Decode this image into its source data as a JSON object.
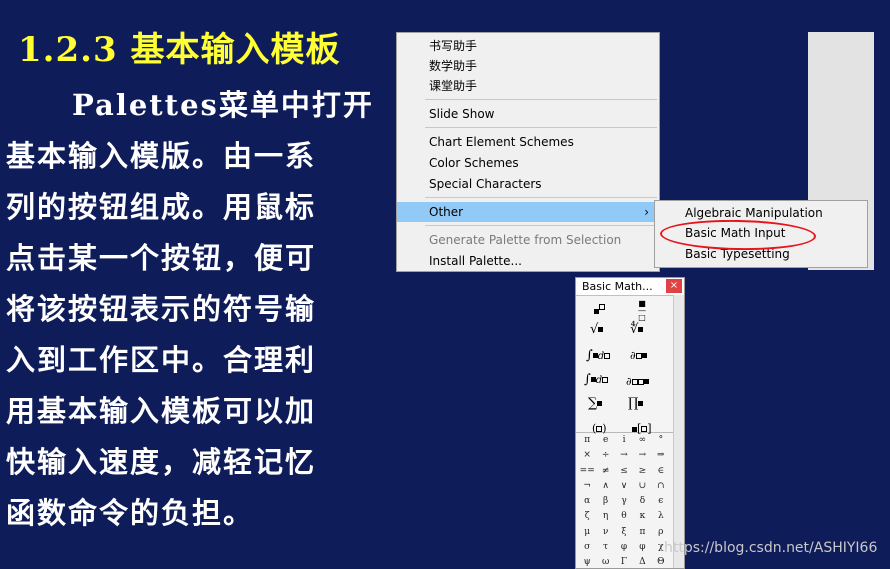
{
  "slide": {
    "title": "1.2.3  基本输入模板",
    "body_lines": [
      "Palettes菜单中打开",
      "基本输入模版。由一系",
      "列的按钮组成。用鼠标",
      "点击某一个按钮，便可",
      "将该按钮表示的符号输",
      "入到工作区中。合理利",
      "用基本输入模板可以加",
      "快输入速度，减轻记忆",
      "函数命令的负担。"
    ]
  },
  "menu": {
    "items": [
      {
        "label": "书写助手"
      },
      {
        "label": "数学助手"
      },
      {
        "label": "课堂助手"
      },
      {
        "label": "Slide Show"
      },
      {
        "label": "Chart Element Schemes"
      },
      {
        "label": "Color Schemes"
      },
      {
        "label": "Special Characters"
      },
      {
        "label": "Other"
      },
      {
        "label": "Generate Palette from Selection"
      },
      {
        "label": "Install Palette..."
      }
    ],
    "submenu_arrow": "›"
  },
  "submenu": {
    "items": [
      {
        "label": "Algebraic Manipulation"
      },
      {
        "label": "Basic Math Input"
      },
      {
        "label": "Basic Typesetting"
      }
    ]
  },
  "palette": {
    "title": "Basic Math...",
    "close": "×",
    "grid": [
      [
        "π",
        "e",
        "i",
        "∞",
        "°"
      ],
      [
        "×",
        "÷",
        "→",
        "→",
        "⇒"
      ],
      [
        "==",
        "≠",
        "≤",
        "≥",
        "∈"
      ],
      [
        "¬",
        "∧",
        "∨",
        "∪",
        "∩"
      ],
      [
        "α",
        "β",
        "γ",
        "δ",
        "ϵ"
      ],
      [
        "ζ",
        "η",
        "θ",
        "κ",
        "λ"
      ],
      [
        "μ",
        "ν",
        "ξ",
        "π",
        "ρ"
      ],
      [
        "σ",
        "τ",
        "φ",
        "φ",
        "χ"
      ],
      [
        "ψ",
        "ω",
        "Γ",
        "Δ",
        "Θ"
      ]
    ]
  },
  "watermark": "https://blog.csdn.net/ASHIYI66"
}
